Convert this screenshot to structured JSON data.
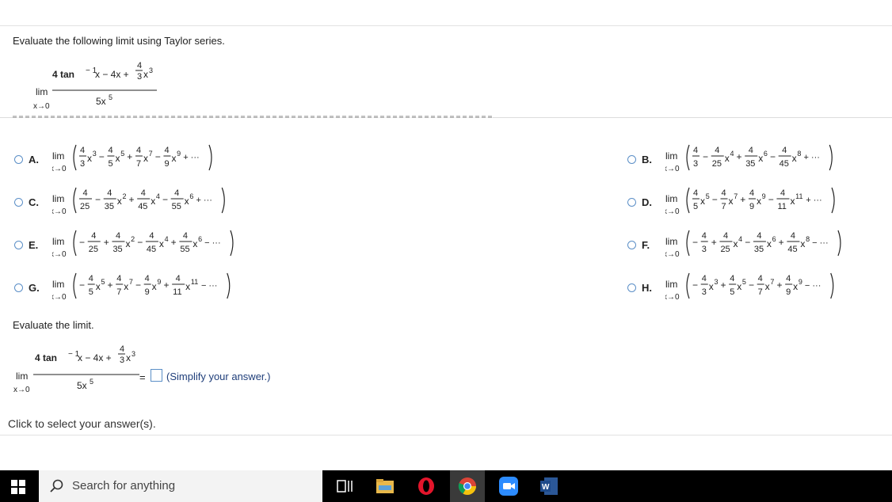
{
  "question": {
    "prompt": "Evaluate the following limit using Taylor series.",
    "numerator_a": "4 tan",
    "numerator_b": "− 1",
    "numerator_c": "x − 4x +",
    "numerator_frac_top": "4",
    "numerator_frac_bot": "3",
    "numerator_tail": "x",
    "numerator_tail_exp": "3",
    "denominator": "5x",
    "denominator_exp": "5",
    "lim_word": "lim",
    "lim_sub": "x→0"
  },
  "options": [
    {
      "letter": "A.",
      "terms": [
        [
          "",
          "4",
          "3",
          "x",
          "3"
        ],
        [
          "−",
          "4",
          "5",
          "x",
          "5"
        ],
        [
          "+",
          "4",
          "7",
          "x",
          "7"
        ],
        [
          "−",
          "4",
          "9",
          "x",
          "9"
        ]
      ],
      "tail": "+ ···"
    },
    {
      "letter": "B.",
      "terms": [
        [
          "",
          "4",
          "3",
          "",
          ""
        ],
        [
          "−",
          "4",
          "25",
          "x",
          "4"
        ],
        [
          "+",
          "4",
          "35",
          "x",
          "6"
        ],
        [
          "−",
          "4",
          "45",
          "x",
          "8"
        ]
      ],
      "tail": "+ ···"
    },
    {
      "letter": "C.",
      "terms": [
        [
          "",
          "4",
          "25",
          "",
          ""
        ],
        [
          "−",
          "4",
          "35",
          "x",
          "2"
        ],
        [
          "+",
          "4",
          "45",
          "x",
          "4"
        ],
        [
          "−",
          "4",
          "55",
          "x",
          "6"
        ]
      ],
      "tail": "+ ···"
    },
    {
      "letter": "D.",
      "terms": [
        [
          "",
          "4",
          "5",
          "x",
          "5"
        ],
        [
          "−",
          "4",
          "7",
          "x",
          "7"
        ],
        [
          "+",
          "4",
          "9",
          "x",
          "9"
        ],
        [
          "−",
          "4",
          "11",
          "x",
          "11"
        ]
      ],
      "tail": "+ ···"
    },
    {
      "letter": "E.",
      "terms": [
        [
          "−",
          "4",
          "25",
          "",
          ""
        ],
        [
          "+",
          "4",
          "35",
          "x",
          "2"
        ],
        [
          "−",
          "4",
          "45",
          "x",
          "4"
        ],
        [
          "+",
          "4",
          "55",
          "x",
          "6"
        ]
      ],
      "tail": "− ···"
    },
    {
      "letter": "F.",
      "terms": [
        [
          "−",
          "4",
          "3",
          "",
          ""
        ],
        [
          "+",
          "4",
          "25",
          "x",
          "4"
        ],
        [
          "−",
          "4",
          "35",
          "x",
          "6"
        ],
        [
          "+",
          "4",
          "45",
          "x",
          "8"
        ]
      ],
      "tail": "− ···"
    },
    {
      "letter": "G.",
      "terms": [
        [
          "−",
          "4",
          "5",
          "x",
          "5"
        ],
        [
          "+",
          "4",
          "7",
          "x",
          "7"
        ],
        [
          "−",
          "4",
          "9",
          "x",
          "9"
        ],
        [
          "+",
          "4",
          "11",
          "x",
          "11"
        ]
      ],
      "tail": "− ···"
    },
    {
      "letter": "H.",
      "terms": [
        [
          "−",
          "4",
          "3",
          "x",
          "3"
        ],
        [
          "+",
          "4",
          "5",
          "x",
          "5"
        ],
        [
          "−",
          "4",
          "7",
          "x",
          "7"
        ],
        [
          "+",
          "4",
          "9",
          "x",
          "9"
        ]
      ],
      "tail": "− ···"
    }
  ],
  "evaluate": {
    "prompt": "Evaluate the limit.",
    "equals": "=",
    "hint": "(Simplify your answer.)"
  },
  "footer": {
    "click_text": "Click to select your answer(s)."
  },
  "taskbar": {
    "search_placeholder": "Search for anything",
    "icons": [
      "windows-start-icon",
      "task-view-icon",
      "file-explorer-icon",
      "opera-icon",
      "chrome-icon",
      "zoom-icon",
      "word-icon"
    ]
  },
  "colors": {
    "accent": "#5b8fc7",
    "taskbar": "#000000"
  }
}
